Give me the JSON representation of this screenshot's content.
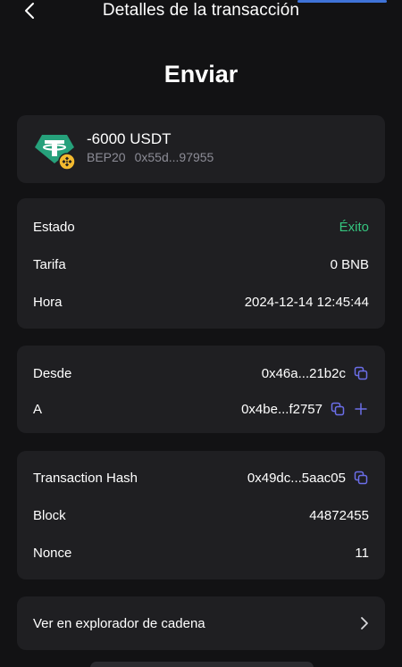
{
  "header": {
    "title": "Detalles de la transacción",
    "back_icon": "chevron-left-icon"
  },
  "page_title": "Enviar",
  "token": {
    "amount": "-6000 USDT",
    "network": "BEP20",
    "address": "0x55d...97955",
    "icon": "tether-usdt-icon",
    "badge_icon": "bnb-chain-badge-icon"
  },
  "details": {
    "status_label": "Estado",
    "status_value": "Éxito",
    "fee_label": "Tarifa",
    "fee_value": "0 BNB",
    "time_label": "Hora",
    "time_value": "2024-12-14 12:45:44"
  },
  "addresses": {
    "from_label": "Desde",
    "from_value": "0x46a...21b2c",
    "to_label": "A",
    "to_value": "0x4be...f2757"
  },
  "tx": {
    "hash_label": "Transaction Hash",
    "hash_value": "0x49dc...5aac05",
    "block_label": "Block",
    "block_value": "44872455",
    "nonce_label": "Nonce",
    "nonce_value": "11"
  },
  "explorer": {
    "label": "Ver en explorador de cadena"
  },
  "colors": {
    "background": "#121214",
    "card": "#1f1f22",
    "success": "#35c57f",
    "icon_accent": "#6b6ee8",
    "tether": "#26a17b",
    "bnb": "#f3ba2f"
  }
}
